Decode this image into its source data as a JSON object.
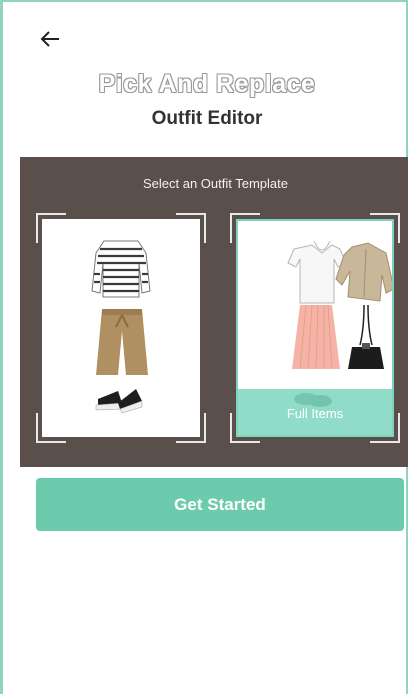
{
  "header": {
    "brand": "Pick And Replace",
    "title": "Outfit Editor",
    "back_icon": "arrow-left-icon"
  },
  "templates": {
    "label": "Select an Outfit Template",
    "items": [
      {
        "outfit": "striped-top-khaki-pants-sneakers",
        "selected": false
      },
      {
        "outfit": "white-tee-pink-pleated-skirt-trench-bag",
        "selected": true,
        "badge": "Full Items"
      }
    ]
  },
  "cta": {
    "label": "Get Started"
  },
  "colors": {
    "accent": "#6ccaad",
    "panel": "#5a4f4a",
    "frame": "#8fd4bb"
  }
}
